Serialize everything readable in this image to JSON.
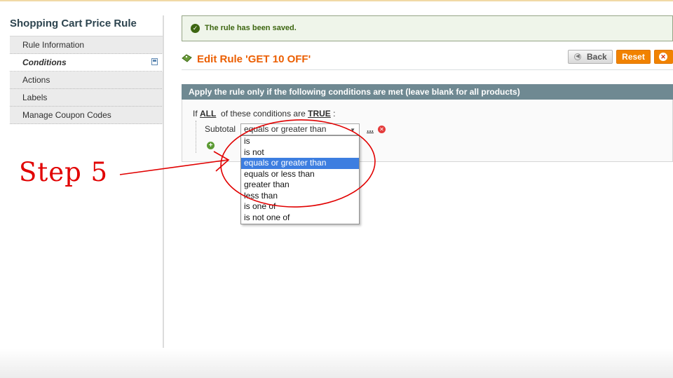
{
  "sidebar": {
    "title": "Shopping Cart Price Rule",
    "tabs": [
      {
        "label": "Rule Information"
      },
      {
        "label": "Conditions"
      },
      {
        "label": "Actions"
      },
      {
        "label": "Labels"
      },
      {
        "label": "Manage Coupon Codes"
      }
    ]
  },
  "message": {
    "text": "The rule has been saved."
  },
  "header": {
    "title": "Edit Rule 'GET 10 OFF'",
    "buttons": {
      "back": "Back",
      "reset": "Reset"
    }
  },
  "conditions": {
    "fieldset_title": "Apply the rule only if the following conditions are met (leave blank for all products)",
    "prefix": "If",
    "aggregator": "ALL",
    "middle": "of these conditions are",
    "value": "TRUE",
    "suffix": ":",
    "attribute": "Subtotal",
    "operator_selected": "equals or greater than",
    "value_placeholder": "...",
    "operator_options": [
      "is",
      "is not",
      "equals or greater than",
      "equals or less than",
      "greater than",
      "less than",
      "is one of",
      "is not one of"
    ],
    "highlighted_option": "equals or greater than"
  },
  "annotation": {
    "label": "Step  5",
    "color": "#e10000"
  },
  "colors": {
    "accent": "#eb5e00",
    "button": "#f18200",
    "fieldset_header": "#6f8992",
    "selection": "#3d7ee0"
  }
}
